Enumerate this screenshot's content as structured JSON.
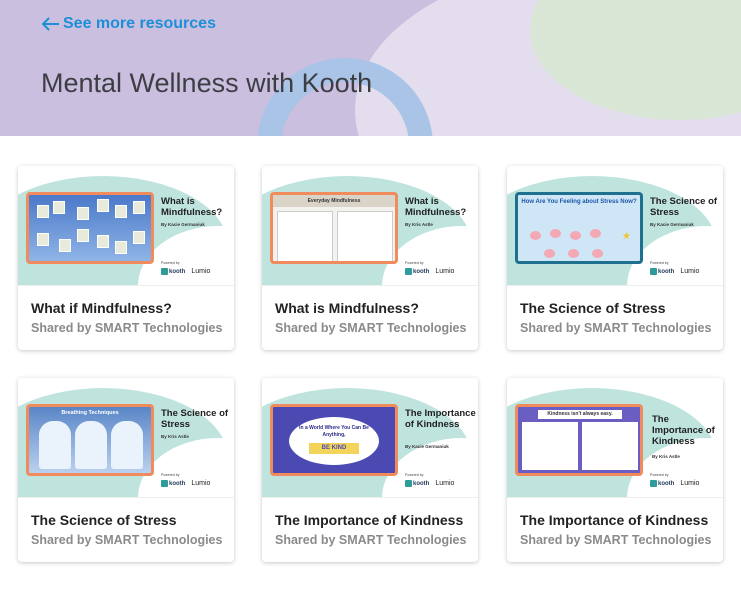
{
  "header": {
    "back_link": "See more resources",
    "title": "Mental Wellness with Kooth"
  },
  "colors": {
    "accent": "#1d8fd6",
    "hero_bg": "#cbbfe0",
    "slide_border": "#ef8b5d"
  },
  "cards": [
    {
      "title": "What if Mindfulness?",
      "shared_by": "Shared by SMART Technologies",
      "thumb_title": "What is Mindfulness?",
      "thumb_author": "By Kacie Germaniuk"
    },
    {
      "title": "What is Mindfulness?",
      "shared_by": "Shared by SMART Technologies",
      "thumb_title": "What is Mindfulness?",
      "thumb_author": "By Kris Astle",
      "slide_heading": "Everyday Mindfulness"
    },
    {
      "title": "The Science of Stress",
      "shared_by": "Shared by SMART Technologies",
      "thumb_title": "The Science of Stress",
      "thumb_author": "By Kacie Germaniuk",
      "slide_heading": "How Are You Feeling about Stress Now?"
    },
    {
      "title": "The Science of Stress",
      "shared_by": "Shared by SMART Technologies",
      "thumb_title": "The Science of Stress",
      "thumb_author": "By Kris Astle",
      "slide_heading": "Breathing Techniques"
    },
    {
      "title": "The Importance of Kindness",
      "shared_by": "Shared by SMART Technologies",
      "thumb_title": "The Importance of Kindness",
      "thumb_author": "By Kacie Germaniuk",
      "slide_heading": "In a World Where You Can Be Anything,",
      "slide_badge": "BE KIND"
    },
    {
      "title": "The Importance of Kindness",
      "shared_by": "Shared by SMART Technologies",
      "thumb_title": "The Importance of Kindness",
      "thumb_author": "By Kris Astle",
      "slide_heading": "Kindness isn't always easy."
    }
  ],
  "branding": {
    "powered": "Powered by",
    "kooth": "kooth",
    "lumio": "Lumio"
  }
}
